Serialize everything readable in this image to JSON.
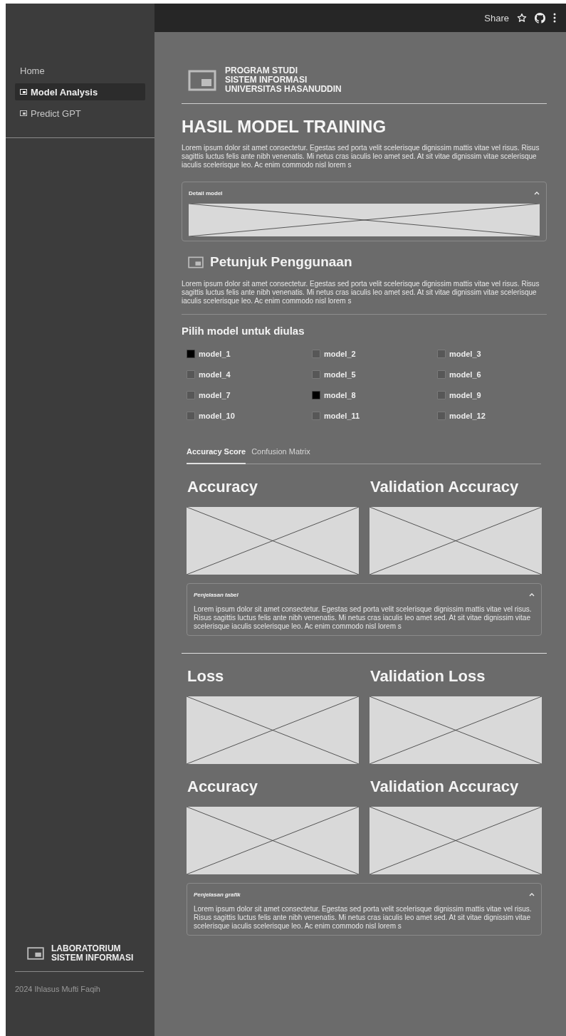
{
  "topbar": {
    "share": "Share"
  },
  "sidebar": {
    "nav": [
      {
        "label": "Home",
        "kind": "plain",
        "selected": false
      },
      {
        "label": "Model Analysis",
        "kind": "page",
        "selected": true
      },
      {
        "label": "Predict GPT",
        "kind": "page",
        "selected": false
      }
    ],
    "footer_logo": [
      "LABORATORIUM",
      "SISTEM INFORMASI"
    ],
    "credit": "2024 Ihlasus Mufti Faqih"
  },
  "header": {
    "logo_lines": [
      "PROGRAM STUDI",
      "SISTEM INFORMASI",
      "UNIVERSITAS HASANUDDIN"
    ]
  },
  "title": "HASIL MODEL TRAINING",
  "intro": "Lorem ipsum dolor sit amet consectetur. Egestas sed porta velit scelerisque dignissim mattis vitae vel risus. Risus sagittis luctus felis ante nibh venenatis. Mi netus cras iaculis leo amet sed. At sit vitae dignissim vitae scelerisque iaculis scelerisque leo. Ac enim commodo nisl lorem s",
  "detail_expander": {
    "title": "Detail model",
    "kind": "figure",
    "expanded": true
  },
  "guide": {
    "heading": "Petunjuk Penggunaan",
    "text": "Lorem ipsum dolor sit amet consectetur. Egestas sed porta velit scelerisque dignissim mattis vitae vel risus. Risus sagittis luctus felis ante nibh venenatis. Mi netus cras iaculis leo amet sed. At sit vitae dignissim vitae scelerisque iaculis scelerisque leo. Ac enim commodo nisl lorem s"
  },
  "model_picker": {
    "heading": "Pilih model untuk diulas",
    "models": [
      {
        "label": "model_1",
        "checked": true
      },
      {
        "label": "model_2",
        "checked": false
      },
      {
        "label": "model_3",
        "checked": false
      },
      {
        "label": "model_4",
        "checked": false
      },
      {
        "label": "model_5",
        "checked": false
      },
      {
        "label": "model_6",
        "checked": false
      },
      {
        "label": "model_7",
        "checked": false
      },
      {
        "label": "model_8",
        "checked": true
      },
      {
        "label": "model_9",
        "checked": false
      },
      {
        "label": "model_10",
        "checked": false
      },
      {
        "label": "model_11",
        "checked": false
      },
      {
        "label": "model_12",
        "checked": false
      }
    ]
  },
  "tabs": [
    {
      "label": "Accuracy Score",
      "selected": true
    },
    {
      "label": "Confusion Matrix",
      "selected": false
    }
  ],
  "panel": [
    {
      "kind": "charts",
      "titles": [
        "Accuracy",
        "Validation Accuracy"
      ]
    },
    {
      "kind": "expander",
      "title": "Penjelasan tabel",
      "expanded": true,
      "text": "Lorem ipsum dolor sit amet consectetur. Egestas sed porta velit scelerisque dignissim mattis vitae vel risus. Risus sagittis luctus felis ante nibh venenatis. Mi netus cras iaculis leo amet sed. At sit vitae dignissim vitae scelerisque iaculis scelerisque leo. Ac enim commodo nisl lorem s"
    },
    {
      "kind": "divider"
    },
    {
      "kind": "charts",
      "titles": [
        "Loss",
        "Validation Loss"
      ]
    },
    {
      "kind": "charts",
      "titles": [
        "Accuracy",
        "Validation Accuracy"
      ]
    },
    {
      "kind": "expander",
      "title": "Penjelasan grafik",
      "expanded": true,
      "text": "Lorem ipsum dolor sit amet consectetur. Egestas sed porta velit scelerisque dignissim mattis vitae vel risus. Risus sagittis luctus felis ante nibh venenatis. Mi netus cras iaculis leo amet sed. At sit vitae dignissim vitae scelerisque iaculis scelerisque leo. Ac enim commodo nisl lorem s"
    }
  ]
}
